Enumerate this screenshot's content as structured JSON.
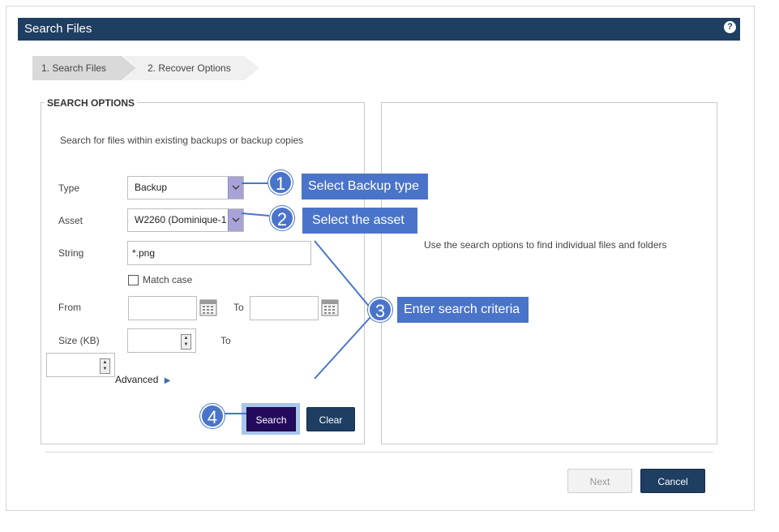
{
  "window": {
    "title": "Search Files",
    "help_icon": "?"
  },
  "steps": [
    {
      "label": "1. Search Files"
    },
    {
      "label": "2. Recover Options"
    }
  ],
  "search_options": {
    "legend": "SEARCH OPTIONS",
    "description": "Search for files within existing backups or backup copies",
    "type_label": "Type",
    "type_value": "Backup",
    "asset_label": "Asset",
    "asset_value": "W2260 (Dominique-1",
    "string_label": "String",
    "string_value": "*.png",
    "match_case_label": "Match case",
    "from_label": "From",
    "to_label": "To",
    "size_label": "Size (KB)",
    "size_to_label": "To",
    "advanced_label": "Advanced",
    "search_button": "Search",
    "clear_button": "Clear"
  },
  "results": {
    "empty_message": "Use the search options to find individual files and folders"
  },
  "footer": {
    "next_button": "Next",
    "cancel_button": "Cancel"
  },
  "callouts": [
    {
      "number": "1",
      "text": "Select Backup type"
    },
    {
      "number": "2",
      "text": "Select the asset"
    },
    {
      "number": "3",
      "text": "Enter search criteria"
    },
    {
      "number": "4",
      "text": ""
    }
  ],
  "colors": {
    "titlebar": "#1e3e62",
    "primary_button": "#1e3e62",
    "callout": "#4a74c9",
    "search_button": "#240a5c"
  }
}
